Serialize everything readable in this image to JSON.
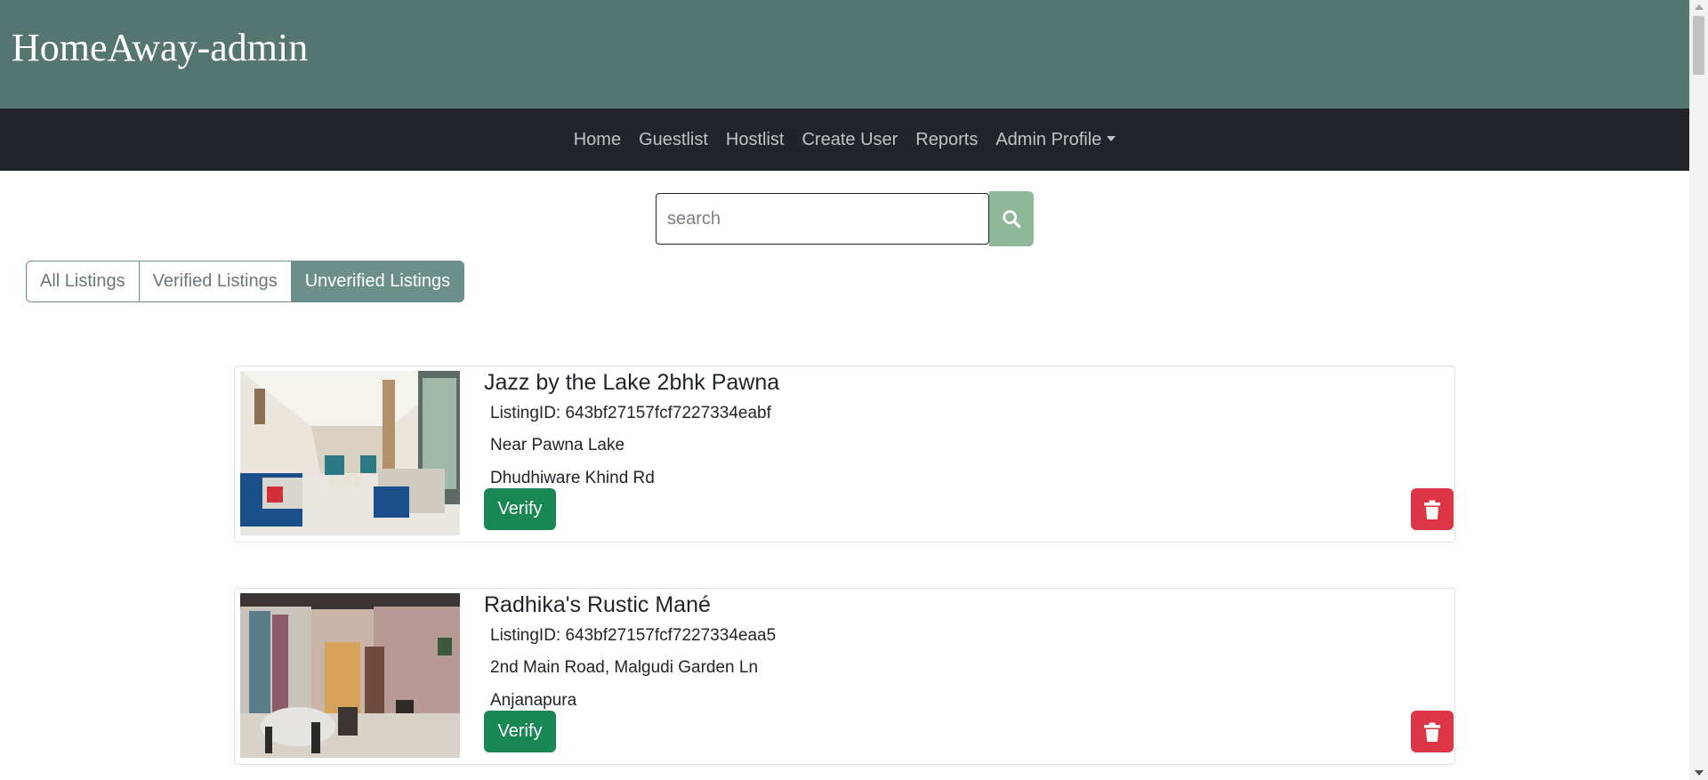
{
  "header": {
    "brand": "HomeAway-admin"
  },
  "nav": {
    "items": [
      "Home",
      "Guestlist",
      "Hostlist",
      "Create User",
      "Reports"
    ],
    "admin_profile": "Admin Profile"
  },
  "search": {
    "placeholder": "search",
    "value": ""
  },
  "filter_tabs": {
    "items": [
      "All Listings",
      "Verified Listings",
      "Unverified Listings"
    ],
    "active": "Unverified Listings"
  },
  "listings": [
    {
      "title": "Jazz by the Lake 2bhk Pawna",
      "listing_id": "ListingID: 643bf27157fcf7227334eabf",
      "address_line1": "Near Pawna Lake",
      "address_line2": "Dhudhiware Khind Rd",
      "verify_label": "Verify"
    },
    {
      "title": "Radhika's Rustic Mané",
      "listing_id": "ListingID: 643bf27157fcf7227334eaa5",
      "address_line1": "2nd Main Road, Malgudi Garden Ln",
      "address_line2": "Anjanapura",
      "verify_label": "Verify"
    }
  ],
  "icons": {
    "search_button": "search-icon",
    "delete_button": "trash-icon",
    "admin_profile": "caret-down-icon"
  },
  "colors": {
    "header_bg": "#557670",
    "navbar_bg": "#212529",
    "search_button": "#8fb89a",
    "tab_active": "#6c8f89",
    "verify_button": "#198754",
    "delete_button": "#dc3545"
  }
}
